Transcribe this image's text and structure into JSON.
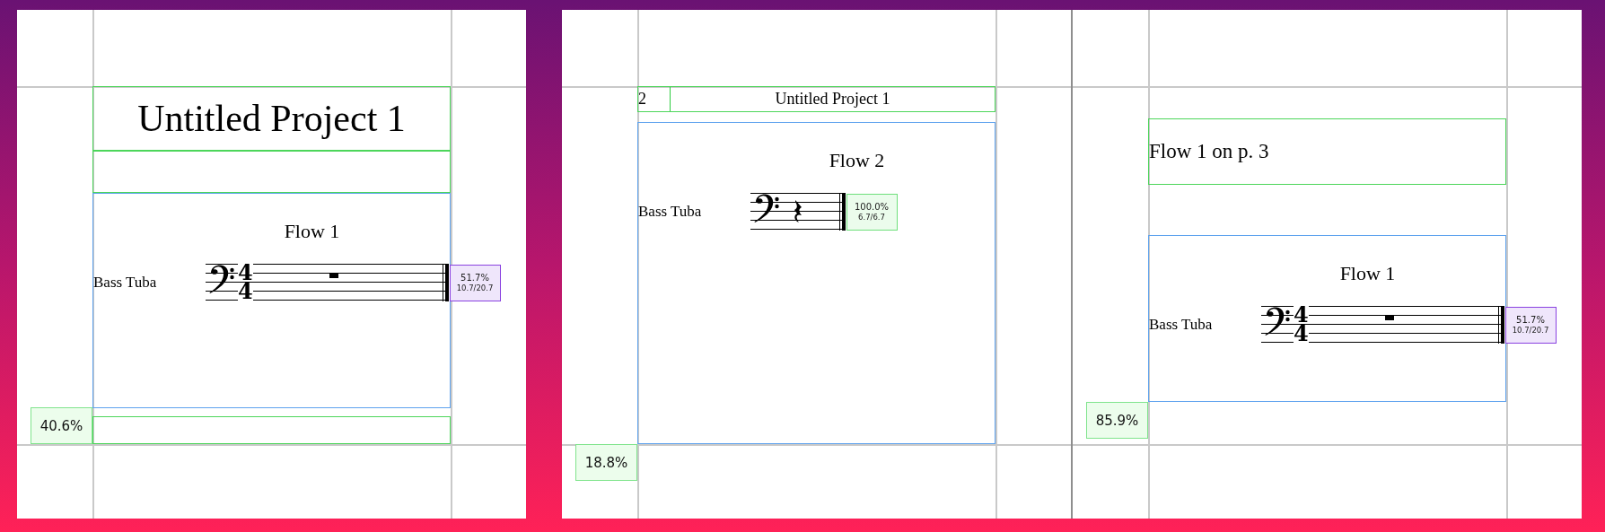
{
  "spreads": [
    {
      "pages": [
        {
          "fill_badge": "40.6%",
          "frames": [
            {
              "kind": "project-title",
              "text": "Untitled Project 1"
            },
            {
              "kind": "text"
            },
            {
              "kind": "music",
              "flow_title": "Flow 1",
              "instrument": "Bass Tuba",
              "time_signature": [
                "4",
                "4"
              ],
              "measure": {
                "kind": "whole-rest"
              },
              "fill": {
                "percent": "51.7%",
                "ratio": "10.7/20.7",
                "complete": false
              }
            },
            {
              "kind": "text"
            }
          ]
        }
      ]
    },
    {
      "pages": [
        {
          "fill_badge": "18.8%",
          "frames": [
            {
              "kind": "header",
              "page_number": "2",
              "title": "Untitled Project 1"
            },
            {
              "kind": "music",
              "flow_title": "Flow 2",
              "instrument": "Bass Tuba",
              "measure": {
                "kind": "quarter-rest"
              },
              "fill": {
                "percent": "100.0%",
                "ratio": "6.7/6.7",
                "complete": true
              }
            }
          ]
        },
        {
          "fill_badge": "85.9%",
          "frames": [
            {
              "kind": "text",
              "text": "Flow 1 on p. 3"
            },
            {
              "kind": "music",
              "flow_title": "Flow 1",
              "instrument": "Bass Tuba",
              "time_signature": [
                "4",
                "4"
              ],
              "measure": {
                "kind": "whole-rest"
              },
              "fill": {
                "percent": "51.7%",
                "ratio": "10.7/20.7",
                "complete": false
              }
            }
          ]
        }
      ]
    }
  ]
}
